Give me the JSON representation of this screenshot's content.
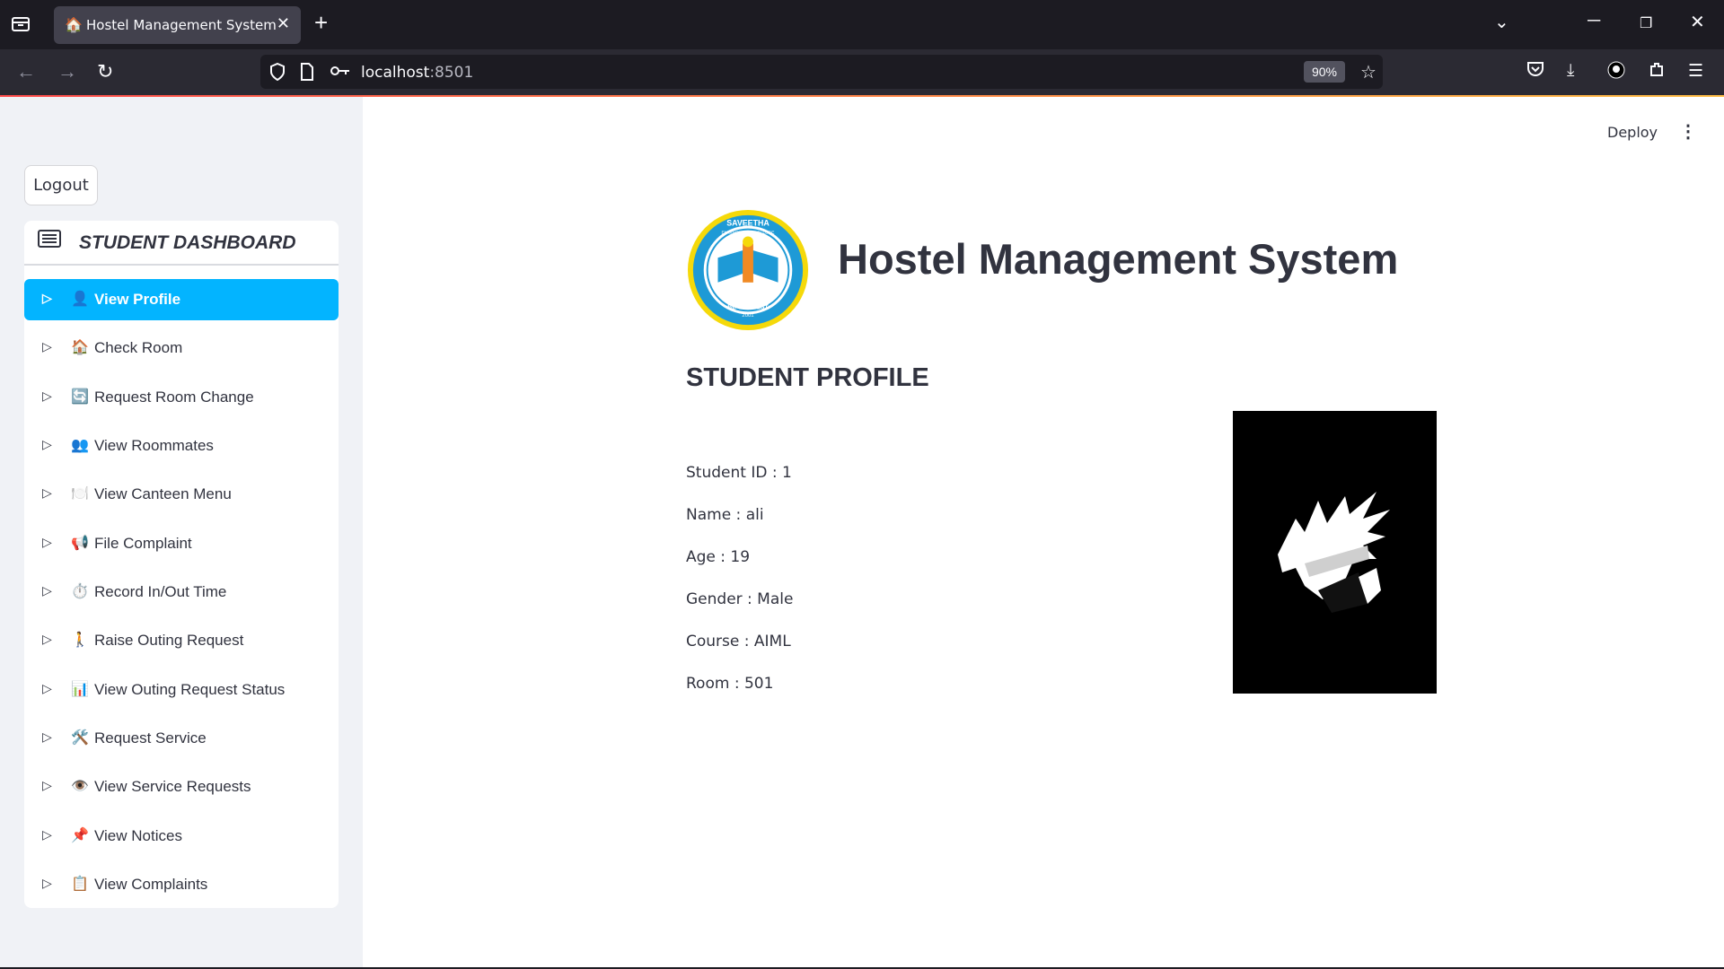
{
  "browser": {
    "tab_title": "Hostel Management System",
    "url_host": "localhost",
    "url_port": ":8501",
    "zoom": "90%"
  },
  "app": {
    "logout_label": "Logout",
    "deploy_label": "Deploy",
    "title": "Hostel Management System",
    "logo_text_top": "SAVEETHA",
    "logo_text_mid": "ENGINEERING COLLEGE",
    "logo_text_bottom": "BE THE BEST",
    "logo_year": "2001"
  },
  "sidebar": {
    "header": "STUDENT DASHBOARD",
    "items": [
      {
        "emoji": "👤",
        "label": "View Profile",
        "active": true
      },
      {
        "emoji": "🏠",
        "label": "Check Room"
      },
      {
        "emoji": "🔄",
        "label": "Request Room Change"
      },
      {
        "emoji": "👥",
        "label": "View Roommates"
      },
      {
        "emoji": "🍽️",
        "label": "View Canteen Menu"
      },
      {
        "emoji": "📢",
        "label": "File Complaint"
      },
      {
        "emoji": "⏱️",
        "label": "Record In/Out Time"
      },
      {
        "emoji": "🚶",
        "label": "Raise Outing Request"
      },
      {
        "emoji": "📊",
        "label": "View Outing Request Status"
      },
      {
        "emoji": "🛠️",
        "label": "Request Service"
      },
      {
        "emoji": "👁️",
        "label": "View Service Requests"
      },
      {
        "emoji": "📌",
        "label": "View Notices"
      },
      {
        "emoji": "📋",
        "label": "View Complaints"
      }
    ]
  },
  "profile": {
    "heading": "STUDENT PROFILE",
    "fields": [
      "Student ID : 1",
      "Name : ali",
      "Age : 19",
      "Gender : Male",
      "Course : AIML",
      "Room : 501"
    ]
  }
}
